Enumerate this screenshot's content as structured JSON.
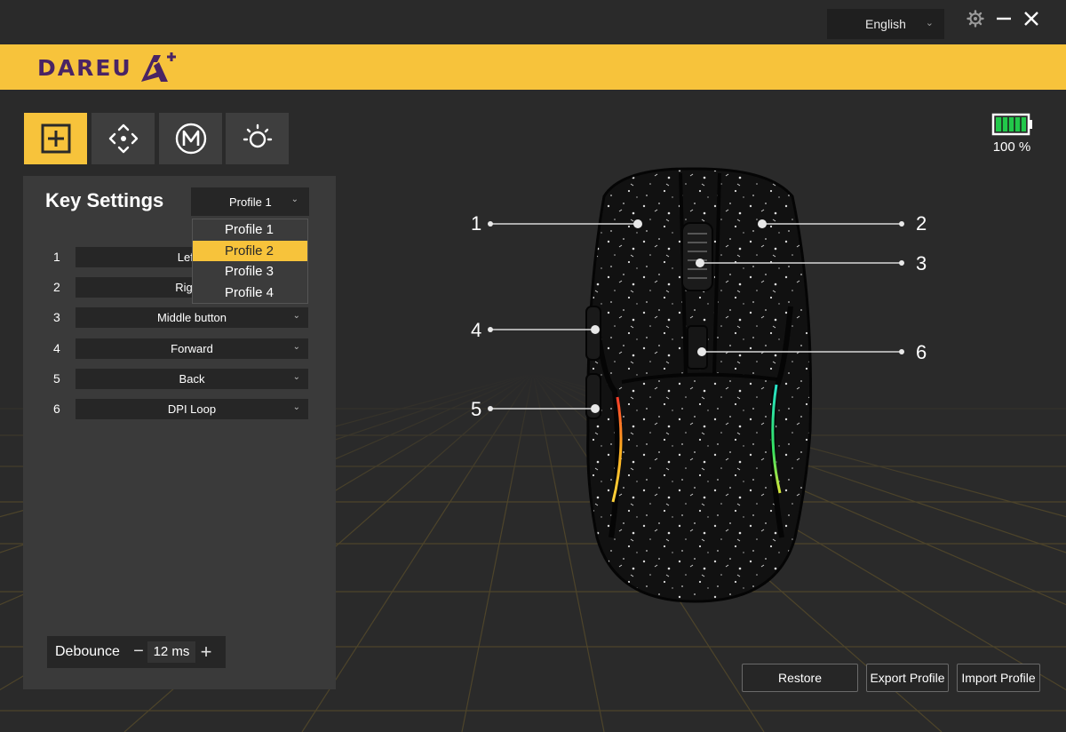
{
  "titlebar": {
    "language": "English",
    "icons": {
      "settings": "gear-icon",
      "minimize": "minimize-icon",
      "close": "close-icon"
    }
  },
  "brand": {
    "logo_text": "DAREU"
  },
  "tabs": [
    {
      "name": "key-settings",
      "icon": "plus-square-icon",
      "active": true
    },
    {
      "name": "dpi",
      "icon": "move-arrows-icon",
      "active": false
    },
    {
      "name": "macro",
      "icon": "macro-m-icon",
      "active": false
    },
    {
      "name": "lighting",
      "icon": "sun-icon",
      "active": false
    }
  ],
  "battery": {
    "level_percent": 100,
    "text": "100 %",
    "color": "#22c84a"
  },
  "panel": {
    "title": "Key Settings",
    "profile_selected": "Profile 1",
    "profile_options": [
      "Profile 1",
      "Profile 2",
      "Profile 3",
      "Profile 4"
    ],
    "highlighted_option": "Profile 2",
    "keys": [
      {
        "num": "1",
        "value": "Left b"
      },
      {
        "num": "2",
        "value": "Right I"
      },
      {
        "num": "3",
        "value": "Middle button"
      },
      {
        "num": "4",
        "value": "Forward"
      },
      {
        "num": "5",
        "value": "Back"
      },
      {
        "num": "6",
        "value": "DPI Loop"
      }
    ],
    "debounce": {
      "label": "Debounce",
      "minus": "−",
      "value": "12 ms",
      "plus": "+"
    }
  },
  "callouts": [
    "1",
    "2",
    "3",
    "4",
    "5",
    "6"
  ],
  "buttons": {
    "restore": "Restore",
    "export": "Export Profile",
    "import": "Import Profile"
  },
  "colors": {
    "accent": "#f7c33b",
    "brand_purple": "#4a2464"
  }
}
